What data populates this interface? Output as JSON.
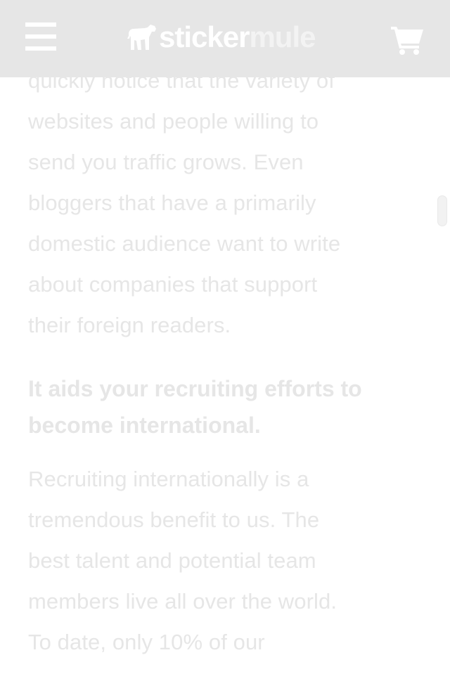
{
  "header": {
    "logo": {
      "word1": "sticker",
      "word2": "mule"
    },
    "menu_icon": "hamburger-icon",
    "cart_icon": "shopping-cart-icon"
  },
  "article": {
    "paragraph1": [
      "quickly notice that the variety of",
      "websites and people willing to",
      "send you traffic grows. Even",
      "bloggers that have a primarily",
      "domestic audience want to write",
      "about companies that support",
      "their foreign readers."
    ],
    "heading": [
      "It aids your recruiting efforts to",
      "become international."
    ],
    "paragraph2": [
      "Recruiting internationally is a",
      "tremendous benefit to us. The",
      "best talent and potential team",
      "members live all over the world.",
      "To date, only 10% of our"
    ]
  },
  "colors": {
    "header_bg": "#e6e6e6",
    "text": "#e6e6e6",
    "page_bg": "#ffffff"
  }
}
